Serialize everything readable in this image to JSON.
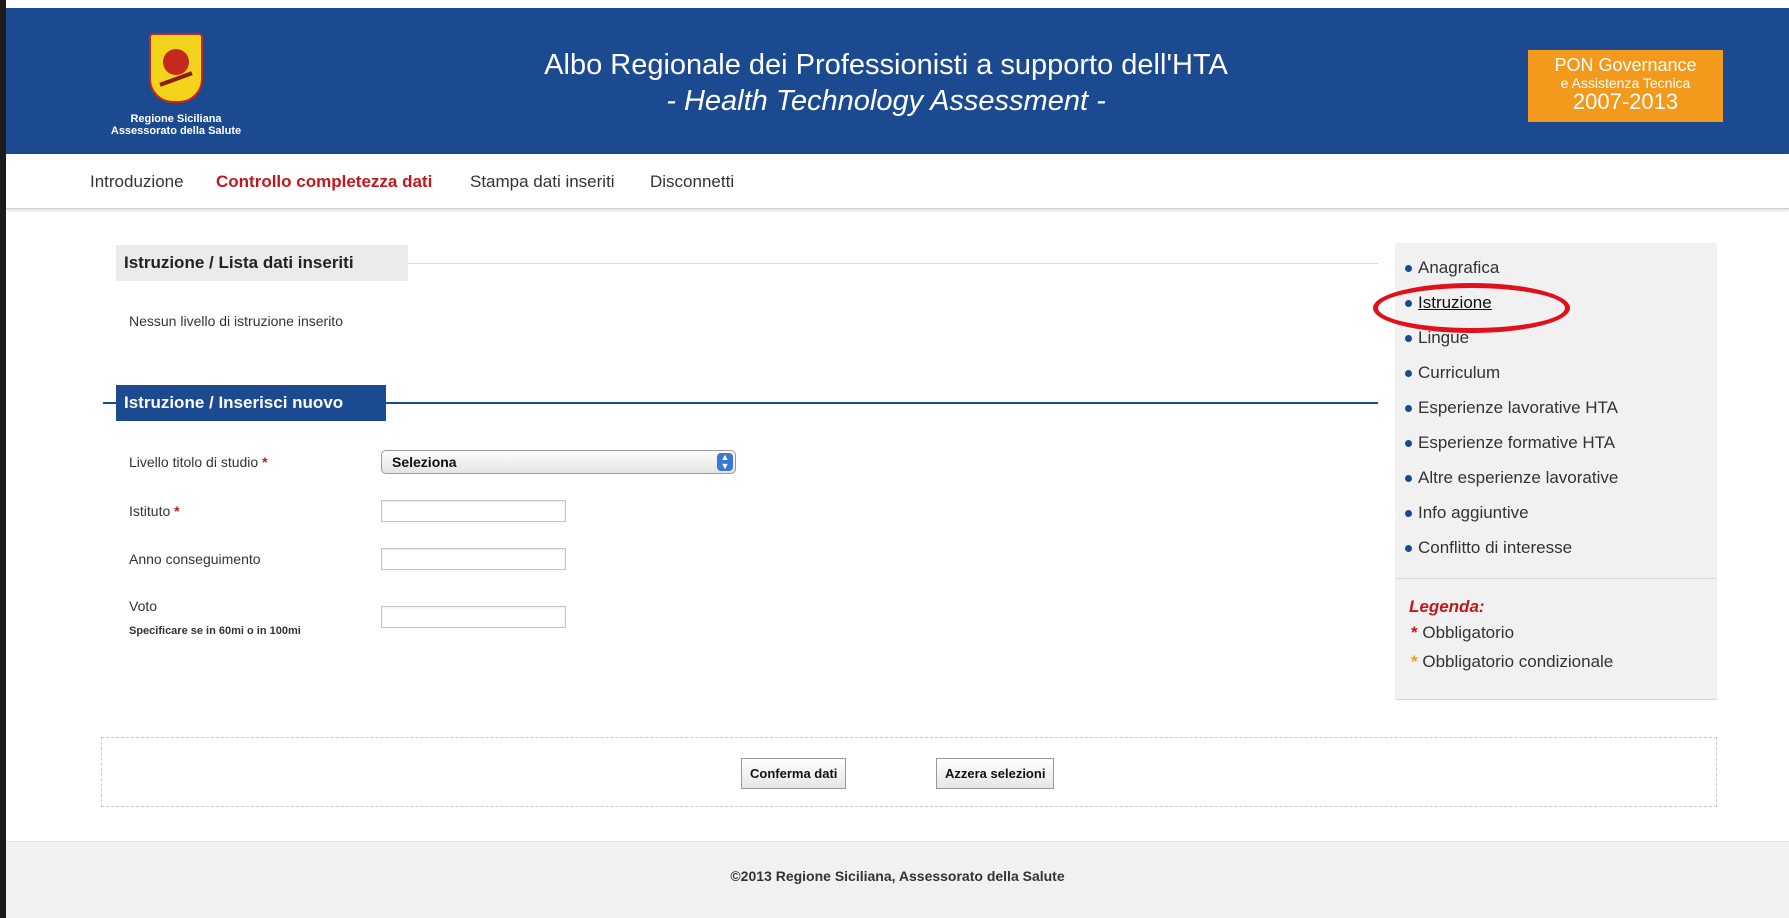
{
  "header": {
    "logo_line1": "Regione Siciliana",
    "logo_line2": "Assessorato della Salute",
    "title": "Albo Regionale dei Professionisti a supporto dell'HTA",
    "subtitle": "- Health Technology Assessment -",
    "badge_line1": "PON Governance",
    "badge_line2": "e Assistenza Tecnica",
    "badge_line3": "2007-2013"
  },
  "nav": {
    "items": [
      {
        "label": "Introduzione",
        "active": false
      },
      {
        "label": "Controllo completezza dati",
        "active": true
      },
      {
        "label": "Stampa dati inseriti",
        "active": false
      },
      {
        "label": "Disconnetti",
        "active": false
      }
    ]
  },
  "list_section": {
    "title": "Istruzione / Lista dati inseriti",
    "empty_message": "Nessun livello di istruzione inserito"
  },
  "new_section": {
    "title": "Istruzione / Inserisci nuovo",
    "fields": {
      "livello_label": "Livello titolo di studio",
      "livello_value": "Seleziona",
      "istituto_label": "Istituto",
      "istituto_value": "",
      "anno_label": "Anno conseguimento",
      "anno_value": "",
      "voto_label": "Voto",
      "voto_hint": "Specificare se in 60mi o in 100mi",
      "voto_value": "",
      "required_mark": "*"
    }
  },
  "sidebar": {
    "items": [
      {
        "label": "Anagrafica",
        "current": false
      },
      {
        "label": "Istruzione",
        "current": true
      },
      {
        "label": "Lingue",
        "current": false
      },
      {
        "label": "Curriculum",
        "current": false
      },
      {
        "label": "Esperienze lavorative HTA",
        "current": false
      },
      {
        "label": "Esperienze formative HTA",
        "current": false
      },
      {
        "label": "Altre esperienze lavorative",
        "current": false
      },
      {
        "label": "Info aggiuntive",
        "current": false
      },
      {
        "label": "Conflitto di interesse",
        "current": false
      }
    ],
    "legenda_title": "Legenda:",
    "legenda_items": [
      {
        "mark": "*",
        "label": "Obbligatorio"
      },
      {
        "mark": "*",
        "label": "Obbligatorio condizionale"
      }
    ]
  },
  "buttons": {
    "confirm": "Conferma dati",
    "reset": "Azzera selezioni"
  },
  "footer": {
    "text": "©2013 Regione Siciliana, Assessorato della Salute"
  },
  "colors": {
    "brand_blue": "#1c4a91",
    "accent_red": "#c3171c",
    "badge_orange": "#f39a1d",
    "highlight_ring": "#e0111b"
  }
}
